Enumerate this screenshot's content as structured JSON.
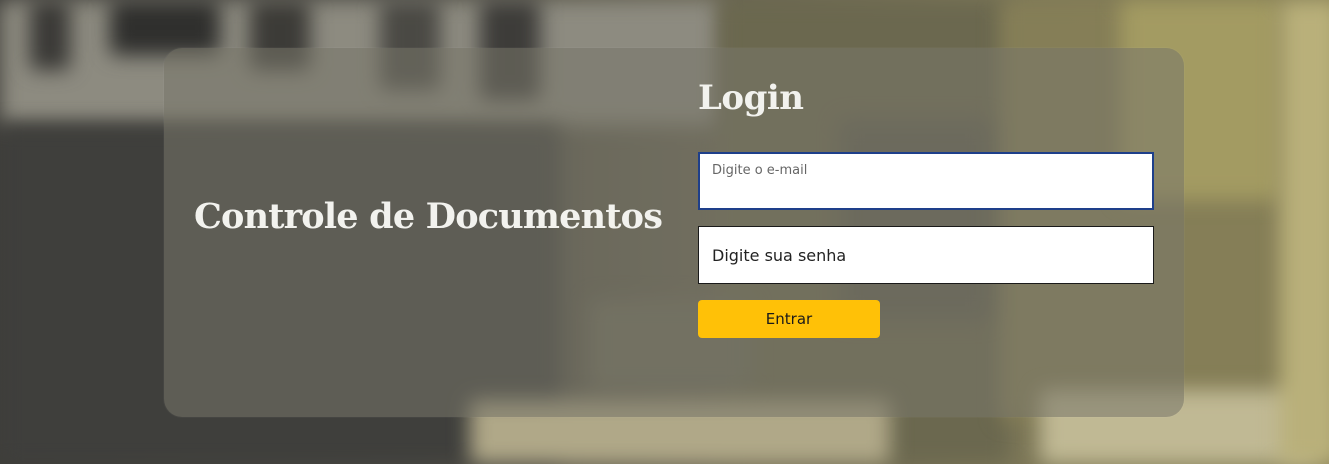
{
  "brand": {
    "title": "Controle de Documentos"
  },
  "login": {
    "title": "Login",
    "email": {
      "label": "Digite o e-mail",
      "value": ""
    },
    "password": {
      "placeholder": "Digite sua senha",
      "value": ""
    },
    "submit_label": "Entrar"
  },
  "colors": {
    "accent": "#ffc107",
    "focus_ring": "#1e3f8a",
    "heading_text": "#f2f2ee"
  }
}
